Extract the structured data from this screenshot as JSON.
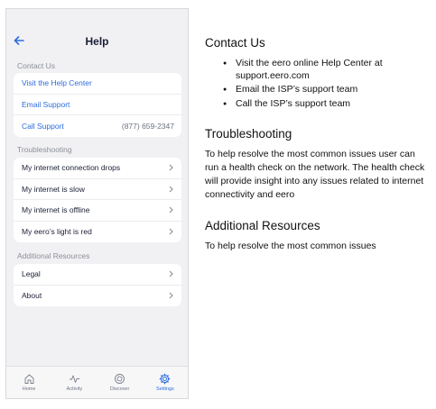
{
  "phone": {
    "header": {
      "title": "Help",
      "back_icon": "back-arrow-icon"
    },
    "sections": [
      {
        "label": "Contact Us",
        "items": [
          {
            "label": "Visit the Help Center",
            "value": ""
          },
          {
            "label": "Email Support",
            "value": ""
          },
          {
            "label": "Call Support",
            "value": "(877) 659-2347"
          }
        ]
      },
      {
        "label": "Troubleshooting",
        "items": [
          {
            "label": "My internet connection drops"
          },
          {
            "label": "My internet is slow"
          },
          {
            "label": "My internet is offline"
          },
          {
            "label": "My eero’s light is red"
          }
        ]
      },
      {
        "label": "Additional Resources",
        "items": [
          {
            "label": "Legal"
          },
          {
            "label": "About"
          }
        ]
      }
    ],
    "tabs": [
      {
        "label": "Home",
        "icon": "home-icon"
      },
      {
        "label": "Activity",
        "icon": "activity-icon"
      },
      {
        "label": "Discover",
        "icon": "discover-icon"
      },
      {
        "label": "Settings",
        "icon": "gear-icon",
        "active": true
      }
    ],
    "colors": {
      "accent": "#2d6cdf",
      "background": "#f1f1f3"
    }
  },
  "doc": {
    "contact": {
      "heading": "Contact Us",
      "bullets": [
        "Visit the eero online Help Center at support.eero.com",
        "Email the ISP’s support team",
        "Call the ISP’s support team"
      ]
    },
    "troubleshooting": {
      "heading": "Troubleshooting",
      "text": "To help resolve the most common issues user can run a health check on the network.  The health check will provide insight into any issues related to internet connectivity and eero"
    },
    "resources": {
      "heading": "Additional Resources",
      "text": "To help resolve the most common issues"
    }
  }
}
